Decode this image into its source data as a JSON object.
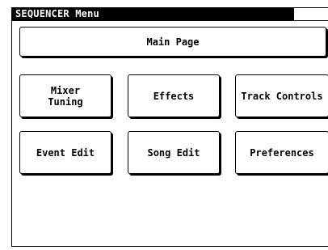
{
  "title": "SEQUENCER Menu",
  "buttons": {
    "main_page": "Main Page",
    "mixer_line1": "Mixer",
    "mixer_line2": "Tuning",
    "effects": "Effects",
    "track_controls": "Track Controls",
    "event_edit": "Event Edit",
    "song_edit": "Song Edit",
    "preferences": "Preferences"
  }
}
